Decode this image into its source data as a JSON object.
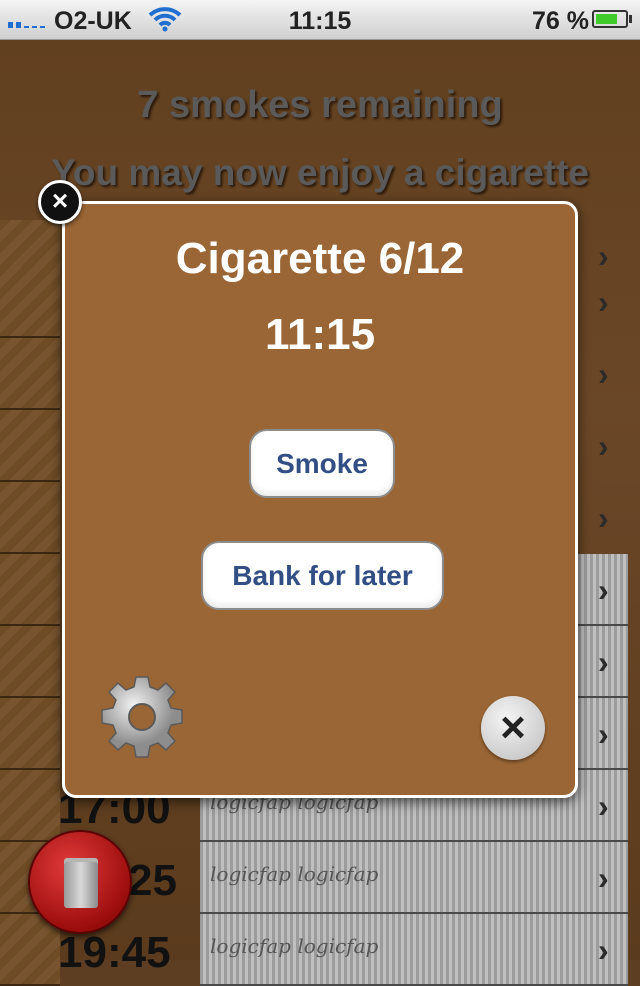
{
  "status_bar": {
    "carrier": "O2-UK",
    "time": "11:15",
    "battery_percent": "76 %",
    "battery_level": 0.76,
    "wifi_icon": "wifi-icon"
  },
  "header": {
    "remaining": "7 smokes remaining",
    "message": "You may now enjoy a cigarette"
  },
  "list": {
    "rows": [
      {
        "time": ""
      },
      {
        "time": ""
      },
      {
        "time": ""
      },
      {
        "time": ""
      },
      {
        "time": ""
      },
      {
        "time": ""
      },
      {
        "time": ""
      },
      {
        "time": ""
      },
      {
        "time": "17:00"
      },
      {
        "time": "25"
      },
      {
        "time": "19:45"
      }
    ],
    "script_text": "logicfap logicfap"
  },
  "modal": {
    "title": "Cigarette 6/12",
    "time": "11:15",
    "smoke_label": "Smoke",
    "bank_label": "Bank for later",
    "close_badge": "×",
    "dismiss": "×"
  },
  "colors": {
    "modal_bg": "#9a6635",
    "button_text": "#324f85"
  }
}
